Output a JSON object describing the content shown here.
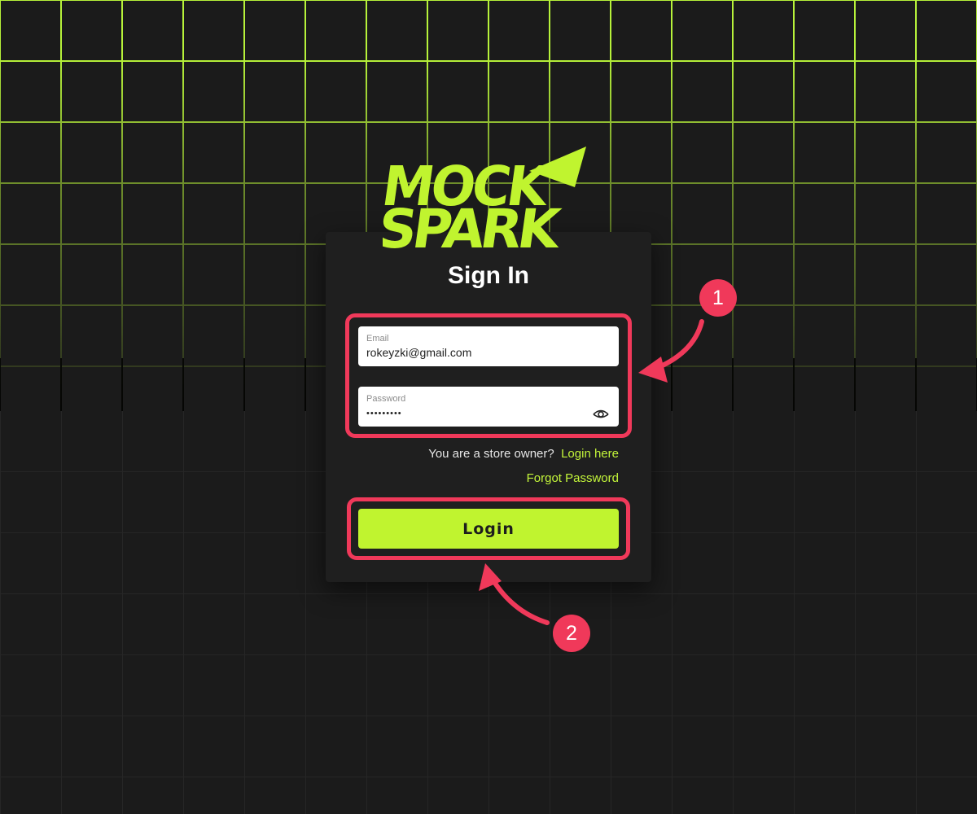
{
  "brand": {
    "line1": "MOCK",
    "line2": "SPARK",
    "logo_color": "#c0f42f"
  },
  "signin": {
    "title": "Sign In",
    "email": {
      "label": "Email",
      "value": "rokeyzki@gmail.com"
    },
    "password": {
      "label": "Password",
      "value": "•••••••••"
    },
    "owner_prompt": "You are a store owner?",
    "owner_link": "Login here",
    "forgot_link": "Forgot Password",
    "login_button": "Login"
  },
  "annotations": {
    "step1": "1",
    "step2": "2",
    "color": "#f0395a"
  },
  "colors": {
    "accent": "#c0f42f",
    "card": "#1f1f1f",
    "background": "#1b1b1b"
  },
  "icons": {
    "password_toggle": "eye-icon"
  }
}
